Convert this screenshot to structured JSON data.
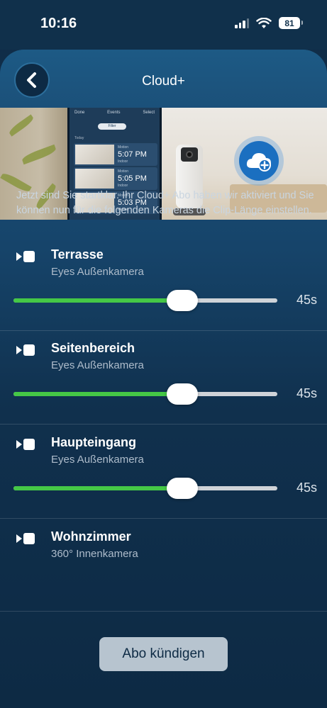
{
  "status_bar": {
    "time": "10:16",
    "battery": "81"
  },
  "header": {
    "title": "Cloud+"
  },
  "hero": {
    "phone_nav_left": "Done",
    "phone_nav_title": "Events",
    "phone_nav_right": "Select",
    "phone_filter": "Filter",
    "phone_today": "Today",
    "events": [
      {
        "label": "Motion",
        "time": "5:07 PM",
        "place": "Indoor"
      },
      {
        "label": "Motion",
        "time": "5:05 PM",
        "place": "Indoor"
      },
      {
        "label": "Motion",
        "time": "5:03 PM",
        "place": "Indoor"
      }
    ]
  },
  "description": "Jetzt sind Sie startklar. Ihr Cloud+ Abo haben wir aktiviert und Sie können nun für die folgenden Kameras die Clip-Länge einstellen.",
  "cameras": [
    {
      "name": "Terrasse",
      "type": "Eyes Außenkamera",
      "clip_length": "45s",
      "slider_fraction": 0.64
    },
    {
      "name": "Seitenbereich",
      "type": "Eyes Außenkamera",
      "clip_length": "45s",
      "slider_fraction": 0.64
    },
    {
      "name": "Haupteingang",
      "type": "Eyes Außenkamera",
      "clip_length": "45s",
      "slider_fraction": 0.64
    },
    {
      "name": "Wohnzimmer",
      "type": "360° Innenkamera",
      "clip_length": "",
      "slider_fraction": null
    }
  ],
  "footer": {
    "cancel_label": "Abo kündigen"
  },
  "colors": {
    "slider_fill": "#45c846",
    "accent": "#1b6fc0"
  }
}
